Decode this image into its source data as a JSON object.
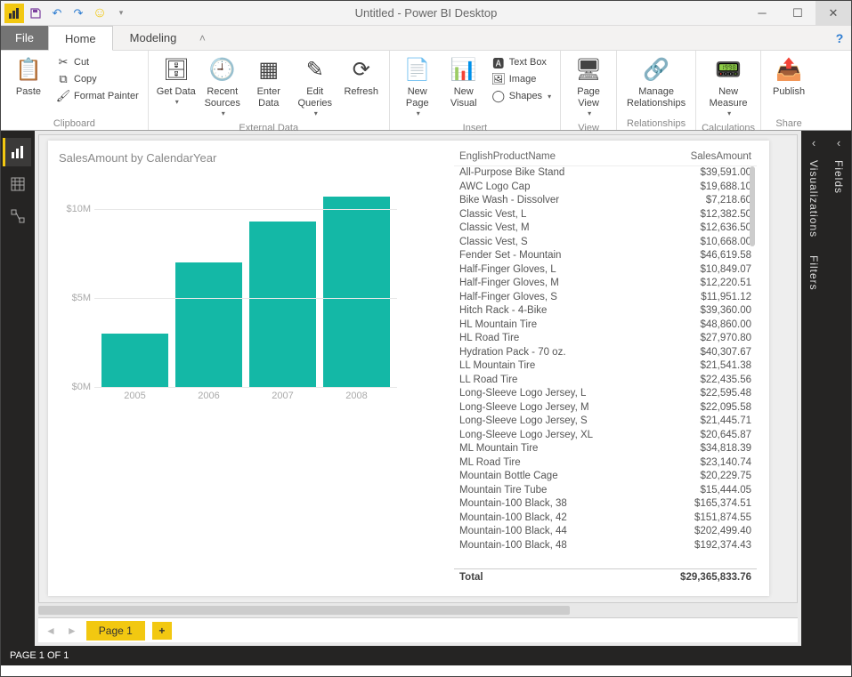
{
  "window": {
    "title": "Untitled - Power BI Desktop"
  },
  "qat": {
    "save": "save-icon",
    "undo": "undo-icon",
    "redo": "redo-icon",
    "smiley": "smiley-icon"
  },
  "tabs": {
    "file": "File",
    "home": "Home",
    "modeling": "Modeling"
  },
  "ribbon": {
    "clipboard": {
      "label": "Clipboard",
      "paste": "Paste",
      "cut": "Cut",
      "copy": "Copy",
      "fmt": "Format Painter"
    },
    "external": {
      "label": "External Data",
      "getdata": "Get Data",
      "recent": "Recent Sources",
      "enter": "Enter Data",
      "edit": "Edit Queries",
      "refresh": "Refresh"
    },
    "insert": {
      "label": "Insert",
      "newpage": "New Page",
      "newvisual": "New Visual",
      "textbox": "Text Box",
      "image": "Image",
      "shapes": "Shapes"
    },
    "view": {
      "label": "View",
      "pageview": "Page View"
    },
    "rel": {
      "label": "Relationships",
      "manage": "Manage Relationships"
    },
    "calc": {
      "label": "Calculations",
      "measure": "New Measure"
    },
    "share": {
      "label": "Share",
      "publish": "Publish"
    }
  },
  "panes": {
    "viz": "Visualizations",
    "filters": "Filters",
    "fields": "Fields"
  },
  "page_tabs": {
    "page1": "Page 1"
  },
  "status": {
    "text": "PAGE 1 OF 1"
  },
  "chart_data": {
    "type": "bar",
    "title": "SalesAmount by CalendarYear",
    "categories": [
      "2005",
      "2006",
      "2007",
      "2008"
    ],
    "values": [
      3000000,
      7000000,
      9300000,
      10700000
    ],
    "ylabel": "",
    "ylim": [
      0,
      11000000
    ],
    "y_ticks": [
      "$0M",
      "$5M",
      "$10M"
    ]
  },
  "table": {
    "col1": "EnglishProductName",
    "col2": "SalesAmount",
    "rows": [
      {
        "n": "All-Purpose Bike Stand",
        "v": "$39,591.00"
      },
      {
        "n": "AWC Logo Cap",
        "v": "$19,688.10"
      },
      {
        "n": "Bike Wash - Dissolver",
        "v": "$7,218.60"
      },
      {
        "n": "Classic Vest, L",
        "v": "$12,382.50"
      },
      {
        "n": "Classic Vest, M",
        "v": "$12,636.50"
      },
      {
        "n": "Classic Vest, S",
        "v": "$10,668.00"
      },
      {
        "n": "Fender Set - Mountain",
        "v": "$46,619.58"
      },
      {
        "n": "Half-Finger Gloves, L",
        "v": "$10,849.07"
      },
      {
        "n": "Half-Finger Gloves, M",
        "v": "$12,220.51"
      },
      {
        "n": "Half-Finger Gloves, S",
        "v": "$11,951.12"
      },
      {
        "n": "Hitch Rack - 4-Bike",
        "v": "$39,360.00"
      },
      {
        "n": "HL Mountain Tire",
        "v": "$48,860.00"
      },
      {
        "n": "HL Road Tire",
        "v": "$27,970.80"
      },
      {
        "n": "Hydration Pack - 70 oz.",
        "v": "$40,307.67"
      },
      {
        "n": "LL Mountain Tire",
        "v": "$21,541.38"
      },
      {
        "n": "LL Road Tire",
        "v": "$22,435.56"
      },
      {
        "n": "Long-Sleeve Logo Jersey, L",
        "v": "$22,595.48"
      },
      {
        "n": "Long-Sleeve Logo Jersey, M",
        "v": "$22,095.58"
      },
      {
        "n": "Long-Sleeve Logo Jersey, S",
        "v": "$21,445.71"
      },
      {
        "n": "Long-Sleeve Logo Jersey, XL",
        "v": "$20,645.87"
      },
      {
        "n": "ML Mountain Tire",
        "v": "$34,818.39"
      },
      {
        "n": "ML Road Tire",
        "v": "$23,140.74"
      },
      {
        "n": "Mountain Bottle Cage",
        "v": "$20,229.75"
      },
      {
        "n": "Mountain Tire Tube",
        "v": "$15,444.05"
      },
      {
        "n": "Mountain-100 Black, 38",
        "v": "$165,374.51"
      },
      {
        "n": "Mountain-100 Black, 42",
        "v": "$151,874.55"
      },
      {
        "n": "Mountain-100 Black, 44",
        "v": "$202,499.40"
      },
      {
        "n": "Mountain-100 Black, 48",
        "v": "$192,374.43"
      }
    ],
    "total_label": "Total",
    "total_value": "$29,365,833.76"
  }
}
